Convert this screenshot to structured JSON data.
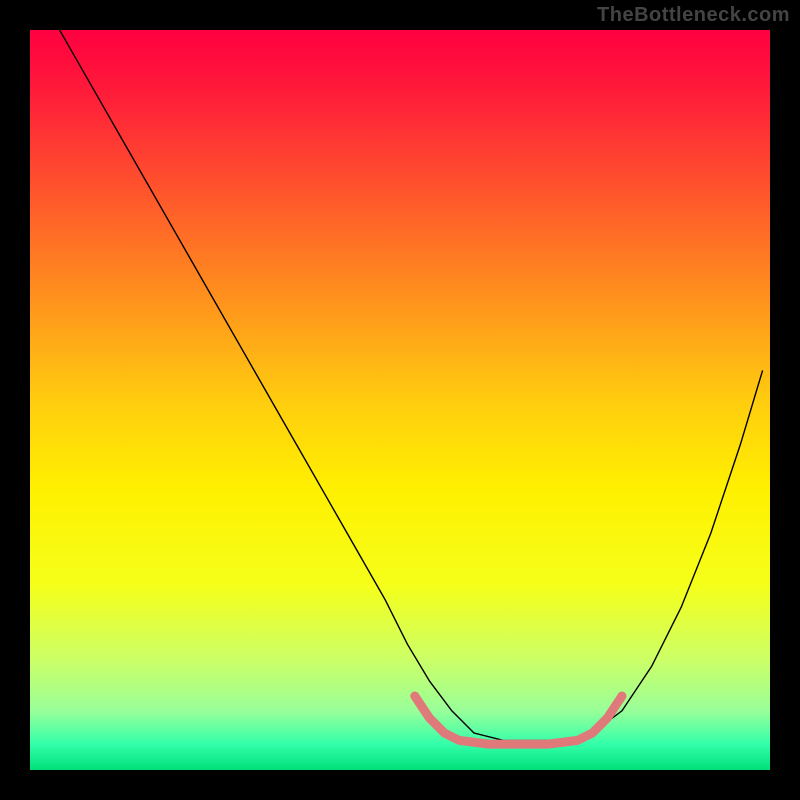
{
  "watermark": "TheBottleneck.com",
  "chart_data": {
    "type": "line",
    "title": "",
    "xlabel": "",
    "ylabel": "",
    "xlim": [
      0,
      100
    ],
    "ylim": [
      0,
      100
    ],
    "grid": false,
    "legend": null,
    "background_gradient": {
      "stops": [
        {
          "offset": 0.0,
          "color": "#ff0040"
        },
        {
          "offset": 0.08,
          "color": "#ff1a3a"
        },
        {
          "offset": 0.2,
          "color": "#ff4d2e"
        },
        {
          "offset": 0.35,
          "color": "#ff8c1e"
        },
        {
          "offset": 0.5,
          "color": "#ffcc0f"
        },
        {
          "offset": 0.62,
          "color": "#fff000"
        },
        {
          "offset": 0.75,
          "color": "#f5ff1a"
        },
        {
          "offset": 0.85,
          "color": "#ccff66"
        },
        {
          "offset": 0.92,
          "color": "#99ff99"
        },
        {
          "offset": 0.965,
          "color": "#33ffaa"
        },
        {
          "offset": 1.0,
          "color": "#00e07a"
        }
      ]
    },
    "series": [
      {
        "name": "bottleneck-curve",
        "color": "#000000",
        "stroke_width": 1.4,
        "x": [
          4,
          8,
          12,
          16,
          20,
          24,
          28,
          32,
          36,
          40,
          44,
          48,
          51,
          54,
          57,
          60,
          64,
          68,
          72,
          76,
          80,
          84,
          88,
          92,
          96,
          99
        ],
        "y": [
          100,
          93,
          86,
          79,
          72,
          65,
          58,
          51,
          44,
          37,
          30,
          23,
          17,
          12,
          8,
          5,
          4,
          4,
          4,
          5,
          8,
          14,
          22,
          32,
          44,
          54
        ]
      },
      {
        "name": "u-emphasis",
        "color": "#e07a7a",
        "stroke_width": 9,
        "linecap": "round",
        "x": [
          52,
          54,
          56,
          58,
          62,
          66,
          70,
          74,
          76,
          78,
          80
        ],
        "y": [
          10,
          7,
          5,
          4,
          3.5,
          3.5,
          3.5,
          4,
          5,
          7,
          10
        ]
      }
    ]
  }
}
